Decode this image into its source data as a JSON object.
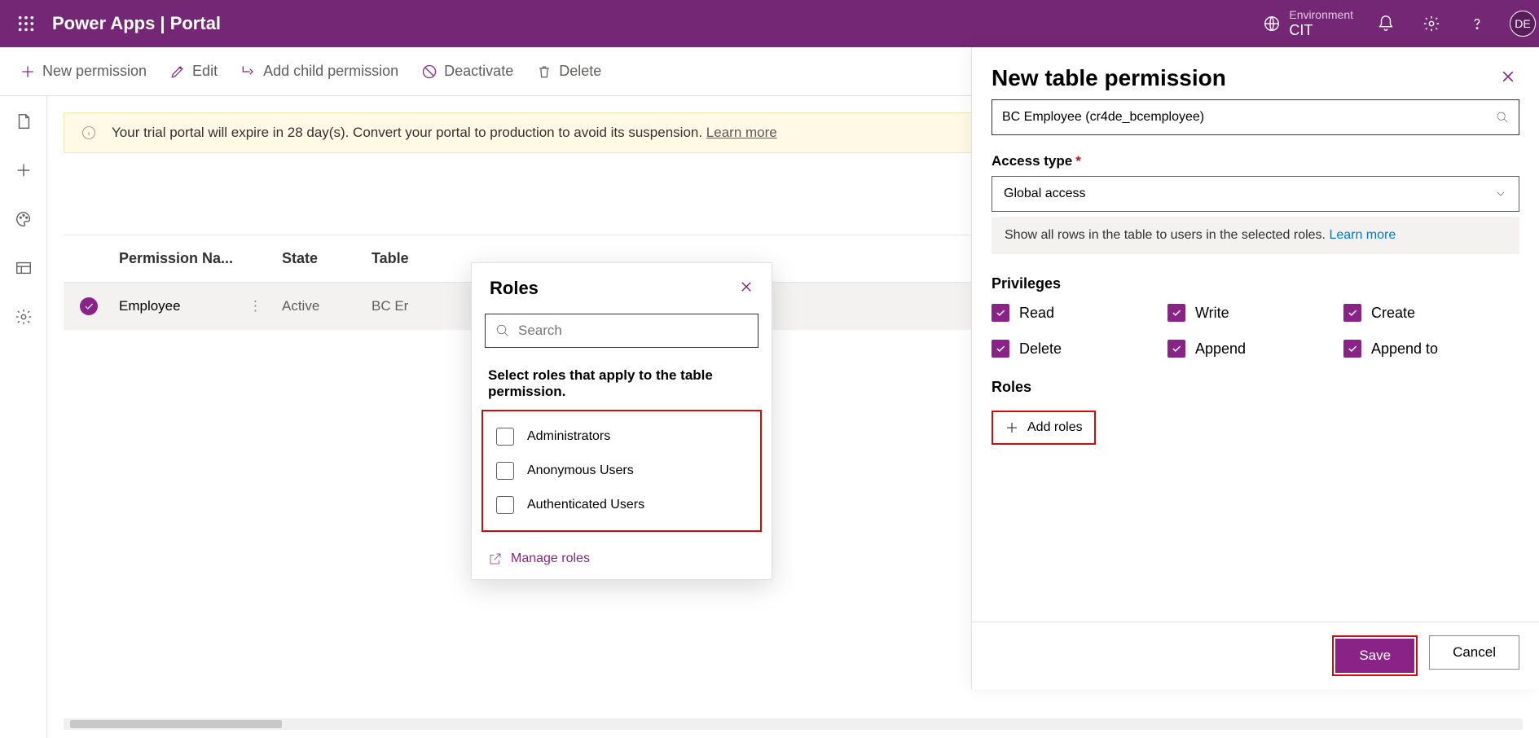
{
  "header": {
    "title": "Power Apps   |   Portal",
    "env_label": "Environment",
    "env_name": "CIT",
    "avatar": "DE"
  },
  "cmdbar": {
    "new_permission": "New permission",
    "edit": "Edit",
    "add_child": "Add child permission",
    "deactivate": "Deactivate",
    "delete": "Delete"
  },
  "banner": {
    "text": "Your trial portal will expire in 28 day(s). Convert your portal to production to avoid its suspension. ",
    "link": "Learn more"
  },
  "table": {
    "cols": {
      "name": "Permission Na...",
      "state": "State",
      "table": "Table"
    },
    "row": {
      "name": "Employee",
      "state": "Active",
      "table": "BC Er"
    }
  },
  "roles_popup": {
    "title": "Roles",
    "search_placeholder": "Search",
    "instruction": "Select roles that apply to the table permission.",
    "options": [
      "Administrators",
      "Anonymous Users",
      "Authenticated Users"
    ],
    "manage": "Manage roles"
  },
  "panel": {
    "title": "New table permission",
    "table_value": "BC Employee (cr4de_bcemployee)",
    "access_type_label": "Access type",
    "access_type_value": "Global access",
    "access_help": "Show all rows in the table to users in the selected roles. ",
    "access_help_link": "Learn more",
    "privileges_label": "Privileges",
    "privs": [
      "Read",
      "Write",
      "Create",
      "Delete",
      "Append",
      "Append to"
    ],
    "roles_label": "Roles",
    "add_roles": "Add roles",
    "save": "Save",
    "cancel": "Cancel"
  }
}
